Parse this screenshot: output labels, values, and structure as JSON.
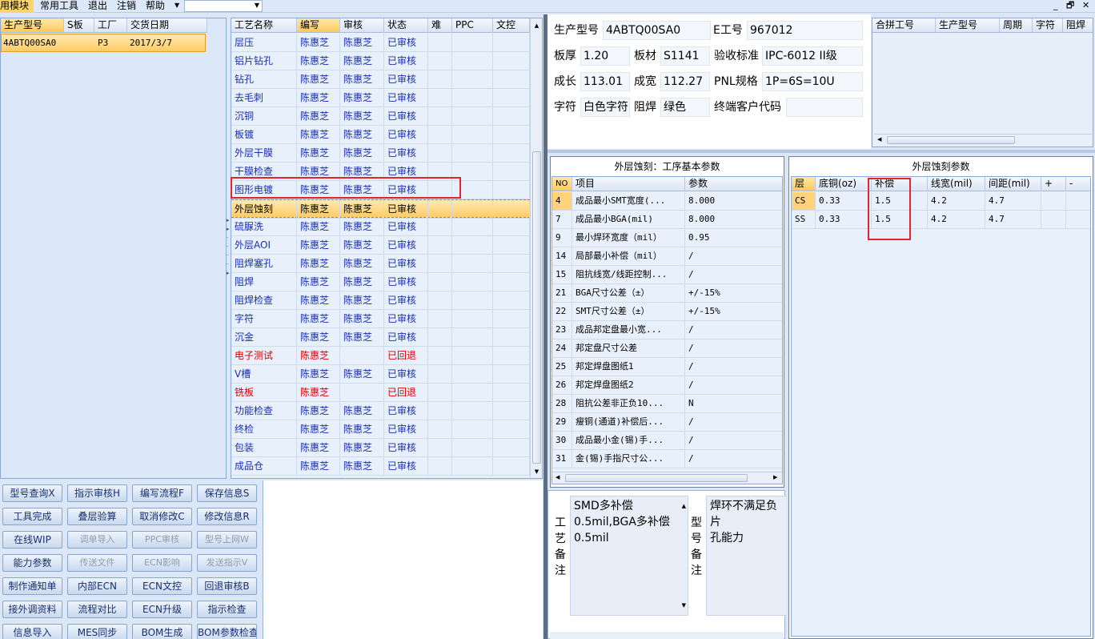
{
  "menubar": {
    "items": [
      "用模块",
      "常用工具",
      "退出",
      "注销",
      "帮助"
    ],
    "combo_value": "",
    "window_controls": [
      "_",
      "🗗",
      "✕"
    ]
  },
  "order_grid": {
    "headers": [
      "生产型号",
      "S板",
      "工厂",
      "交货日期"
    ],
    "rows": [
      {
        "model": "4ABTQ00SA0",
        "s": "",
        "factory": "P3",
        "date": "2017/3/7"
      }
    ]
  },
  "process_grid": {
    "headers": [
      "工艺名称",
      "编写",
      "审核",
      "状态",
      "难",
      "PPC",
      "文控"
    ],
    "rows": [
      {
        "name": "层压",
        "writer": "陈惠芝",
        "reviewer": "陈惠芝",
        "status": "已审核"
      },
      {
        "name": "铝片钻孔",
        "writer": "陈惠芝",
        "reviewer": "陈惠芝",
        "status": "已审核"
      },
      {
        "name": "钻孔",
        "writer": "陈惠芝",
        "reviewer": "陈惠芝",
        "status": "已审核"
      },
      {
        "name": "去毛刺",
        "writer": "陈惠芝",
        "reviewer": "陈惠芝",
        "status": "已审核"
      },
      {
        "name": "沉铜",
        "writer": "陈惠芝",
        "reviewer": "陈惠芝",
        "status": "已审核"
      },
      {
        "name": "板镀",
        "writer": "陈惠芝",
        "reviewer": "陈惠芝",
        "status": "已审核"
      },
      {
        "name": "外层干膜",
        "writer": "陈惠芝",
        "reviewer": "陈惠芝",
        "status": "已审核"
      },
      {
        "name": "干膜检查",
        "writer": "陈惠芝",
        "reviewer": "陈惠芝",
        "status": "已审核"
      },
      {
        "name": "图形电镀",
        "writer": "陈惠芝",
        "reviewer": "陈惠芝",
        "status": "已审核"
      },
      {
        "name": "外层蚀刻",
        "writer": "陈惠芝",
        "reviewer": "陈惠芝",
        "status": "已审核"
      },
      {
        "name": "硫脲洗",
        "writer": "陈惠芝",
        "reviewer": "陈惠芝",
        "status": "已审核"
      },
      {
        "name": "外层AOI",
        "writer": "陈惠芝",
        "reviewer": "陈惠芝",
        "status": "已审核"
      },
      {
        "name": "阻焊塞孔",
        "writer": "陈惠芝",
        "reviewer": "陈惠芝",
        "status": "已审核"
      },
      {
        "name": "阻焊",
        "writer": "陈惠芝",
        "reviewer": "陈惠芝",
        "status": "已审核"
      },
      {
        "name": "阻焊检查",
        "writer": "陈惠芝",
        "reviewer": "陈惠芝",
        "status": "已审核"
      },
      {
        "name": "字符",
        "writer": "陈惠芝",
        "reviewer": "陈惠芝",
        "status": "已审核"
      },
      {
        "name": "沉金",
        "writer": "陈惠芝",
        "reviewer": "陈惠芝",
        "status": "已审核"
      },
      {
        "name": "电子测试",
        "writer": "陈惠芝",
        "reviewer": "",
        "status": "已回退"
      },
      {
        "name": "V槽",
        "writer": "陈惠芝",
        "reviewer": "陈惠芝",
        "status": "已审核"
      },
      {
        "name": "铣板",
        "writer": "陈惠芝",
        "reviewer": "",
        "status": "已回退"
      },
      {
        "name": "功能检查",
        "writer": "陈惠芝",
        "reviewer": "陈惠芝",
        "status": "已审核"
      },
      {
        "name": "终检",
        "writer": "陈惠芝",
        "reviewer": "陈惠芝",
        "status": "已审核"
      },
      {
        "name": "包装",
        "writer": "陈惠芝",
        "reviewer": "陈惠芝",
        "status": "已审核"
      },
      {
        "name": "成品仓",
        "writer": "陈惠芝",
        "reviewer": "陈惠芝",
        "status": "已审核"
      }
    ]
  },
  "buttons": [
    [
      "型号查询X",
      "指示审核H",
      "编写流程F",
      "保存信息S"
    ],
    [
      "工具完成",
      "叠层验算",
      "取消修改C",
      "修改信息R"
    ],
    [
      "在线WIP",
      "调单导入",
      "PPC审核",
      "型号上网W"
    ],
    [
      "能力参数",
      "传送文件",
      "ECN影响",
      "发送指示V"
    ],
    [
      "制作通知单",
      "内部ECN",
      "ECN文控",
      "回退审核B"
    ],
    [
      "接外调资料",
      "流程对比",
      "ECN升级",
      "指示检查"
    ],
    [
      "信息导入",
      "MES同步",
      "BOM生成",
      "BOM参数检查"
    ]
  ],
  "info": {
    "model_label": "生产型号",
    "model": "4ABTQ00SA0",
    "ework_label": "E工号",
    "ework": "967012",
    "thick_label": "板厚",
    "thick": "1.20",
    "material_label": "板材",
    "material": "S1141",
    "accept_label": "验收标准",
    "accept": "IPC-6012 II级",
    "length_label": "成长",
    "length": "113.01",
    "width_label": "成宽",
    "width": "112.27",
    "pnl_label": "PNL规格",
    "pnl": "1P=6S=10U",
    "char_label": "字符",
    "char": "白色字符",
    "mask_label": "阻焊",
    "mask": "绿色",
    "customer_label": "终端客户代码",
    "customer": ""
  },
  "combine_grid": {
    "headers": [
      "合拼工号",
      "生产型号",
      "周期",
      "字符",
      "阻焊"
    ]
  },
  "params_panel": {
    "title": "外层蚀刻：工序基本参数",
    "headers": [
      "NO",
      "项目",
      "参数"
    ],
    "rows": [
      {
        "no": "4",
        "item": "成品最小SMT宽度(...",
        "value": "8.000"
      },
      {
        "no": "7",
        "item": "成品最小BGA(mil)",
        "value": "8.000"
      },
      {
        "no": "9",
        "item": "最小焊环宽度（mil）",
        "value": "0.95"
      },
      {
        "no": "14",
        "item": "局部最小补偿（mil）",
        "value": "/"
      },
      {
        "no": "15",
        "item": "阻抗线宽/线距控制...",
        "value": "/"
      },
      {
        "no": "21",
        "item": "BGA尺寸公差（±）",
        "value": "+/-15%"
      },
      {
        "no": "22",
        "item": "SMT尺寸公差（±）",
        "value": "+/-15%"
      },
      {
        "no": "23",
        "item": "成品邦定盘最小宽...",
        "value": "/"
      },
      {
        "no": "24",
        "item": "邦定盘尺寸公差",
        "value": "/"
      },
      {
        "no": "25",
        "item": "邦定焊盘图纸1",
        "value": "/"
      },
      {
        "no": "26",
        "item": "邦定焊盘图纸2",
        "value": "/"
      },
      {
        "no": "28",
        "item": "阻抗公差非正负10...",
        "value": "N"
      },
      {
        "no": "29",
        "item": "瘦铜(通道)补偿后...",
        "value": "/"
      },
      {
        "no": "30",
        "item": "成品最小金(锡)手...",
        "value": "/"
      },
      {
        "no": "31",
        "item": "金(锡)手指尺寸公...",
        "value": "/"
      }
    ]
  },
  "etch_panel": {
    "title": "外层蚀刻参数",
    "headers": [
      "层",
      "底铜(oz)",
      "补偿",
      "线宽(mil)",
      "间距(mil)",
      "+",
      "-"
    ],
    "rows": [
      {
        "layer": "CS",
        "cu": "0.33",
        "comp": "1.5",
        "lw": "4.2",
        "sp": "4.7"
      },
      {
        "layer": "SS",
        "cu": "0.33",
        "comp": "1.5",
        "lw": "4.2",
        "sp": "4.7"
      }
    ]
  },
  "process_memo": {
    "label": [
      "工",
      "艺",
      "备",
      "注"
    ],
    "text": [
      "SMD多补偿",
      "0.5mil,BGA多补偿",
      "0.5mil"
    ]
  },
  "model_memo": {
    "label": [
      "型",
      "号",
      "备",
      "注"
    ],
    "text": [
      "焊环不满足负片",
      "孔能力"
    ]
  }
}
